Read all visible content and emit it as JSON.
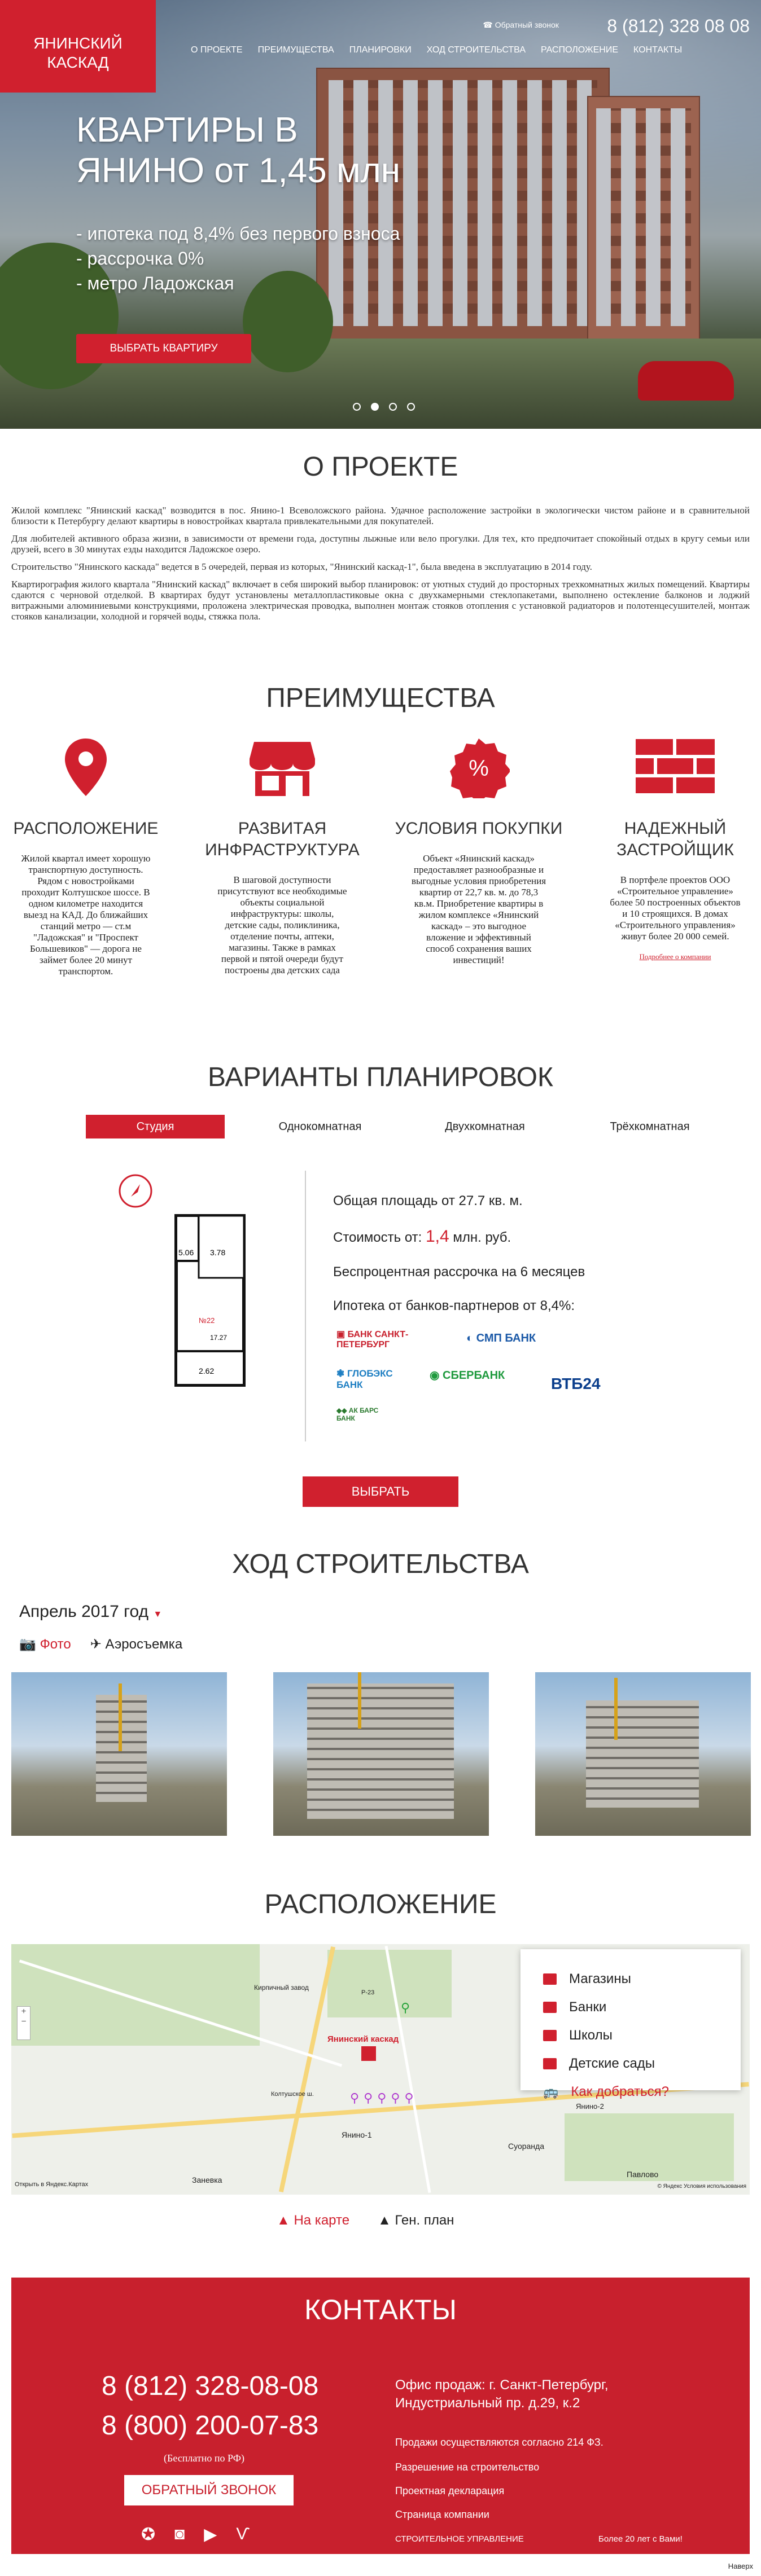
{
  "header": {
    "logo_line1": "ЯНИНСКИЙ",
    "logo_line2": "КАСКАД",
    "callback": "Обратный звонок",
    "phone": "8 (812) 328 08 08",
    "nav": [
      "О ПРОЕКТЕ",
      "ПРЕИМУЩЕСТВА",
      "ПЛАНИРОВКИ",
      "ХОД СТРОИТЕЛЬСТВА",
      "РАСПОЛОЖЕНИЕ",
      "КОНТАКТЫ"
    ]
  },
  "hero": {
    "title1": "КВАРТИРЫ В",
    "title2": "ЯНИНО от 1,45 млн",
    "items": [
      "- ипотека под 8,4% без первого взноса",
      "- рассрочка 0%",
      "- метро Ладожская"
    ],
    "button": "ВЫБРАТЬ КВАРТИРУ",
    "slides": 4,
    "active_slide": 2
  },
  "about": {
    "title": "О ПРОЕКТЕ",
    "paragraphs": [
      "Жилой комплекс \"Янинский каскад\" возводится в пос. Янино-1 Всеволожского района. Удачное расположение застройки в экологически чистом районе и в сравнительной близости к Петербургу делают квартиры в новостройках квартала привлекательными для покупателей.",
      "Для любителей активного образа жизни, в зависимости от времени года, доступны лыжные или вело прогулки. Для тех, кто предпочитает спокойный отдых в кругу семьи или друзей, всего в 30 минутах езды находится Ладожское озеро.",
      "Строительство \"Янинского каскада\" ведется в 5 очередей, первая из которых, \"Янинский каскад-1\", была введена в эксплуатацию в 2014 году.",
      "Квартирография жилого квартала \"Янинский каскад\" включает в себя широкий выбор планировок: от уютных студий до просторных трехкомнатных жилых помещений. Квартиры сдаются с черновой отделкой. В квартирах будут установлены металлопластиковые окна с двухкамерными стеклопакетами, выполнено остекление балконов и лоджий витражными алюминиевыми конструкциями, проложена электрическая проводка, выполнен монтаж стояков отопления с установкой радиаторов и полотенцесушителей, монтаж стояков канализации, холодной и горячей воды, стяжка пола."
    ]
  },
  "advantages": {
    "title": "ПРЕИМУЩЕСТВА",
    "items": [
      {
        "icon": "map-pin-icon",
        "title": "РАСПОЛОЖЕНИЕ",
        "text": "Жилой квартал имеет хорошую транспортную доступность. Рядом с новостройками проходит Колтушское шоссе. В одном километре находится выезд на КАД. До ближайших станций метро — ст.м \"Ладожская\" и \"Проспект Большевиков\" — дорога не займет более 20 минут транспортом."
      },
      {
        "icon": "shop-icon",
        "title": "РАЗВИТАЯ ИНФРАСТРУКТУРА",
        "text": "В шаговой доступности присутствуют все необходимые объекты социальной инфраструктуры: школы, детские сады, поликлиника, отделение почты, аптеки, магазины. Также в рамках первой и пятой очереди будут построены два детских сада"
      },
      {
        "icon": "percent-icon",
        "title": "УСЛОВИЯ ПОКУПКИ",
        "text": "Объект «Янинский каскад» предоставляет разнообразные и выгодные условия приобретения квартир от 22,7 кв. м. до 78,3 кв.м. Приобретение квартиры в жилом комплексе «Янинский каскад» – это выгодное вложение и эффективный способ сохранения ваших инвестиций!"
      },
      {
        "icon": "brick-wall-icon",
        "title": "НАДЕЖНЫЙ ЗАСТРОЙЩИК",
        "text": "В портфеле проектов ООО «Строительное управление» более 50 построенных объектов и 10 строящихся. В домах «Строительного управления» живут более 20 000 семей.",
        "link": "Подробнее о компании"
      }
    ]
  },
  "plans": {
    "title": "ВАРИАНТЫ ПЛАНИРОВОК",
    "tabs": [
      "Студия",
      "Однокомнатная",
      "Двухкомнатная",
      "Трёхкомнатная"
    ],
    "active_tab": 0,
    "area_text": "Общая площадь от 27.7 кв. м.",
    "price_prefix": "Стоимость от: ",
    "price_value": "1,4",
    "price_suffix": " млн. руб.",
    "installment": "Беспроцентная рассрочка на 6 месяцев",
    "mortgage": "Ипотека от банков-партнеров от 8,4%:",
    "room_labels": [
      "5.06",
      "3.78",
      "17.27",
      "2.62"
    ],
    "unit_no": "№22",
    "banks": [
      "БАНК САНКТ-ПЕТЕРБУРГ",
      "СМП БАНК",
      "ГЛОБЭКС БАНК",
      "СБЕРБАНК",
      "ВТБ24",
      "АК БАРС БАНК"
    ],
    "button": "ВЫБРАТЬ"
  },
  "construction": {
    "title": "ХОД СТРОИТЕЛЬСТВА",
    "month": "Апрель 2017 год",
    "tabs": [
      "Фото",
      "Аэросъемка"
    ],
    "active_tab": 0
  },
  "location": {
    "title": "РАСПОЛОЖЕНИЕ",
    "legend": [
      "Магазины",
      "Банки",
      "Школы",
      "Детские сады",
      "Как добраться?"
    ],
    "map_label": "Янинский каскад",
    "places": [
      "Янино-1",
      "Суоранда",
      "Павлово",
      "Заневка",
      "Янино-2",
      "Кирпичный завод"
    ],
    "roads": [
      "Колтушское ш.",
      "Р-23"
    ],
    "open_in": "Открыть в Яндекс.Картах",
    "copyright": "© Яндекс Условия использования",
    "tabs": [
      "На карте",
      "Ген. план"
    ],
    "active_tab": 0
  },
  "contacts": {
    "title": "КОНТАКТЫ",
    "phone1": "8 (812) 328-08-08",
    "phone2": "8 (800) 200-07-83",
    "free": "(Бесплатно по РФ)",
    "button": "ОБРАТНЫЙ ЗВОНОК",
    "office": "Офис продаж: г. Санкт-Петербург, Индустриальный пр. д.29, к.2",
    "links": [
      "Продажи осуществляются согласно 214 ФЗ.",
      "Разрешение на строительство",
      "Проектная декларация",
      "Страница компании"
    ],
    "su_name": "СТРОИТЕЛЬНОЕ УПРАВЛЕНИЕ",
    "su_years": "Более 20 лет с Вами!"
  },
  "footer": {
    "credit": "Наверх"
  }
}
